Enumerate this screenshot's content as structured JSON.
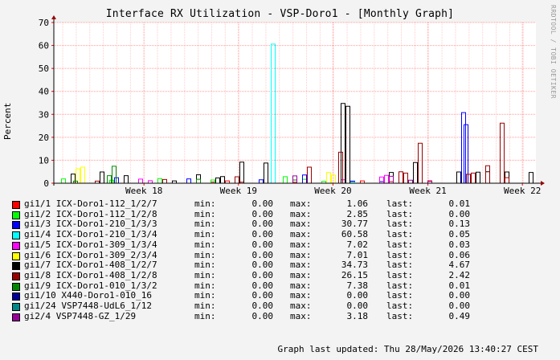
{
  "chart_data": {
    "type": "line",
    "title": "Interface RX Utilization - VSP-Doro1 - [Monthly Graph]",
    "ylabel": "Percent",
    "ylim": [
      0,
      70
    ],
    "yticks": [
      0,
      10,
      20,
      30,
      40,
      50,
      60,
      70
    ],
    "xticks": [
      "Week 18",
      "Week 19",
      "Week 20",
      "Week 21",
      "Week 22"
    ],
    "grid": true,
    "watermark": "RRDTOOL / TOBI OETIKER",
    "legend_stat_labels": {
      "min": "min:",
      "max": "max:",
      "last": "last:"
    },
    "series": [
      {
        "name": "gi1/1 ICX-Doro1-112_1/2/7",
        "color": "#ff0000",
        "min": "0.00",
        "max": "1.06",
        "last": "0.01",
        "points": [
          [
            0.33,
            0.5
          ],
          [
            0.36,
            1.0
          ],
          [
            0.39,
            0.5
          ],
          [
            0.5,
            0.4
          ],
          [
            0.62,
            0.8
          ],
          [
            0.64,
            1.0
          ],
          [
            0.7,
            0.7
          ],
          [
            0.78,
            1.06
          ]
        ]
      },
      {
        "name": "gi1/2 ICX-Doro1-112_1/2/8",
        "color": "#00ff00",
        "min": "0.00",
        "max": "2.85",
        "last": "0.00",
        "points": [
          [
            0.02,
            1.9
          ],
          [
            0.12,
            1.3
          ],
          [
            0.22,
            2.0
          ],
          [
            0.33,
            1.4
          ],
          [
            0.48,
            2.85
          ],
          [
            0.52,
            1.7
          ],
          [
            0.56,
            0.8
          ]
        ]
      },
      {
        "name": "gi1/3 ICX-Doro1-210_1/3/3",
        "color": "#0000ff",
        "min": "0.00",
        "max": "30.77",
        "last": "0.13",
        "points": [
          [
            0.13,
            2.4
          ],
          [
            0.28,
            1.9
          ],
          [
            0.43,
            1.5
          ],
          [
            0.52,
            3.6
          ],
          [
            0.62,
            0.9
          ],
          [
            0.68,
            0.7
          ],
          [
            0.85,
            30.77
          ],
          [
            0.855,
            25.5
          ]
        ]
      },
      {
        "name": "gi1/4 ICX-Doro1-210_1/3/4",
        "color": "#00ffff",
        "min": "0.00",
        "max": "60.58",
        "last": "0.05",
        "points": [
          [
            0.455,
            60.58
          ],
          [
            0.62,
            0.5
          ]
        ]
      },
      {
        "name": "gi1/5 ICX-Doro1-309_1/3/4",
        "color": "#ff00ff",
        "min": "0.00",
        "max": "7.02",
        "last": "0.03",
        "points": [
          [
            0.18,
            1.8
          ],
          [
            0.2,
            1.1
          ],
          [
            0.6,
            1.5
          ],
          [
            0.68,
            2.7
          ],
          [
            0.69,
            3.4
          ]
        ]
      },
      {
        "name": "gi1/6 ICX-Doro1-309_2/3/4",
        "color": "#ffff00",
        "min": "0.00",
        "max": "7.01",
        "last": "0.06",
        "points": [
          [
            0.05,
            6.3
          ],
          [
            0.06,
            7.01
          ],
          [
            0.57,
            4.7
          ],
          [
            0.58,
            3.5
          ]
        ]
      },
      {
        "name": "gi1/7 ICX-Doro1-408_1/2/7",
        "color": "#000000",
        "min": "0.00",
        "max": "34.73",
        "last": "4.67",
        "points": [
          [
            0.04,
            4.0
          ],
          [
            0.1,
            4.9
          ],
          [
            0.15,
            3.3
          ],
          [
            0.25,
            1.0
          ],
          [
            0.3,
            3.7
          ],
          [
            0.34,
            2.3
          ],
          [
            0.35,
            2.9
          ],
          [
            0.39,
            9.2
          ],
          [
            0.44,
            8.8
          ],
          [
            0.6,
            34.73
          ],
          [
            0.61,
            33.5
          ],
          [
            0.7,
            4.7
          ],
          [
            0.75,
            9.0
          ],
          [
            0.84,
            4.9
          ],
          [
            0.88,
            4.8
          ],
          [
            0.9,
            5.0
          ],
          [
            0.94,
            4.9
          ],
          [
            0.99,
            4.67
          ]
        ]
      },
      {
        "name": "gi1/8 ICX-Doro1-408_1/2/8",
        "color": "#990000",
        "min": "0.00",
        "max": "26.15",
        "last": "2.42",
        "points": [
          [
            0.09,
            0.9
          ],
          [
            0.23,
            1.6
          ],
          [
            0.38,
            2.8
          ],
          [
            0.53,
            7.0
          ],
          [
            0.595,
            13.5
          ],
          [
            0.72,
            5.0
          ],
          [
            0.73,
            4.4
          ],
          [
            0.76,
            17.4
          ],
          [
            0.86,
            3.9
          ],
          [
            0.87,
            4.4
          ],
          [
            0.9,
            7.6
          ],
          [
            0.93,
            26.15
          ],
          [
            0.94,
            2.42
          ]
        ]
      },
      {
        "name": "gi1/9 ICX-Doro1-010_1/3/2",
        "color": "#008800",
        "min": "0.00",
        "max": "7.38",
        "last": "0.01",
        "points": [
          [
            0.045,
            0.9
          ],
          [
            0.115,
            3.3
          ],
          [
            0.125,
            7.38
          ],
          [
            0.3,
            1.7
          ],
          [
            0.5,
            1.4
          ]
        ]
      },
      {
        "name": "gi1/10 X440-Doro1-010_16",
        "color": "#000099",
        "min": "0.00",
        "max": "0.00",
        "last": "0.00",
        "points": []
      },
      {
        "name": "gi1/24 VSP7448-UdL6_1/12",
        "color": "#008888",
        "min": "0.00",
        "max": "0.00",
        "last": "0.00",
        "points": []
      },
      {
        "name": "gi2/4 VSP7448-GZ_1/29",
        "color": "#990099",
        "min": "0.00",
        "max": "3.18",
        "last": "0.49",
        "points": [
          [
            0.5,
            3.18
          ],
          [
            0.7,
            3.0
          ],
          [
            0.74,
            1.3
          ],
          [
            0.78,
            0.8
          ]
        ]
      }
    ]
  },
  "footer": "Graph last updated: Thu 28/May/2026 13:40:27 CEST"
}
